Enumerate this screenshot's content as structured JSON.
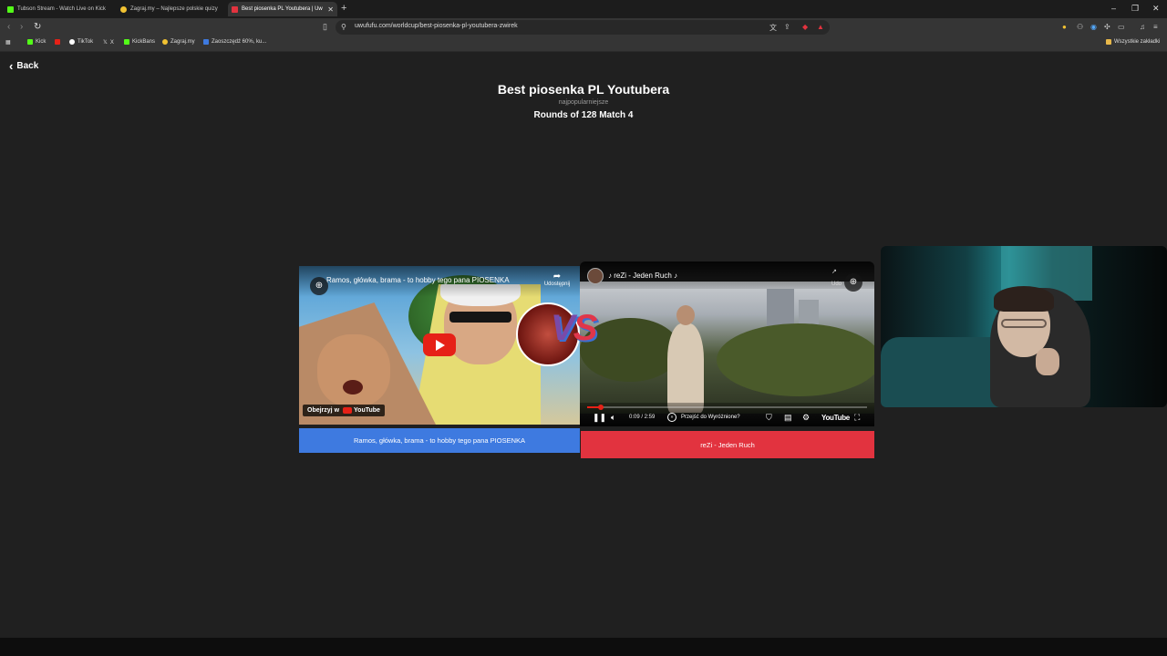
{
  "browser": {
    "tabs": [
      {
        "title": "Tubson Stream - Watch Live on Kick",
        "active": false
      },
      {
        "title": "Zagraj.my – Najlepsze polskie quizy",
        "active": false
      },
      {
        "title": "Best piosenka PL Youtubera | Uw",
        "active": true
      }
    ],
    "new_tab": "+",
    "url": "uwufufu.com/worldcup/best-piosenka-pl-youtubera-zwirek",
    "bookmarks": [
      {
        "label": "Kick",
        "color": "#53fc18"
      },
      {
        "label": "",
        "color": "#e62117"
      },
      {
        "label": "TikTok",
        "color": "#ffffff"
      },
      {
        "label": "X",
        "color": "#ffffff"
      },
      {
        "label": "KickBans",
        "color": "#53fc18"
      },
      {
        "label": "Zagraj.my",
        "color": "#f1c232"
      },
      {
        "label": "Zaoszczędź 60%, ku...",
        "color": "#3e7ae0"
      }
    ],
    "all_bookmarks": "Wszystkie zakładki"
  },
  "page": {
    "back_label": "Back",
    "title": "Best piosenka PL Youtubera",
    "subtitle": "najpopularniejsze",
    "round": "Rounds of 128 Match 4",
    "vs": {
      "v": "V",
      "s": "S"
    }
  },
  "left_video": {
    "title": "Ramos, główka, brama - to hobby tego pana PIOSENKA",
    "share_label": "Udostępnij",
    "watch_on": "Obejrzyj w",
    "watch_brand": "YouTube",
    "choice_label": "Ramos, główka, brama - to hobby tego pana PIOSENKA",
    "choice_color": "#3e7ae0"
  },
  "right_video": {
    "title": "♪ reZi - Jeden Ruch ♪",
    "share_label": "Udo",
    "time": "0:09 / 2:59",
    "progress": 0.05,
    "skip_label": "Przejść do Wyróżnione?",
    "brand": "YouTube",
    "choice_label": "reZi - Jeden Ruch",
    "choice_color": "#e2333f"
  }
}
